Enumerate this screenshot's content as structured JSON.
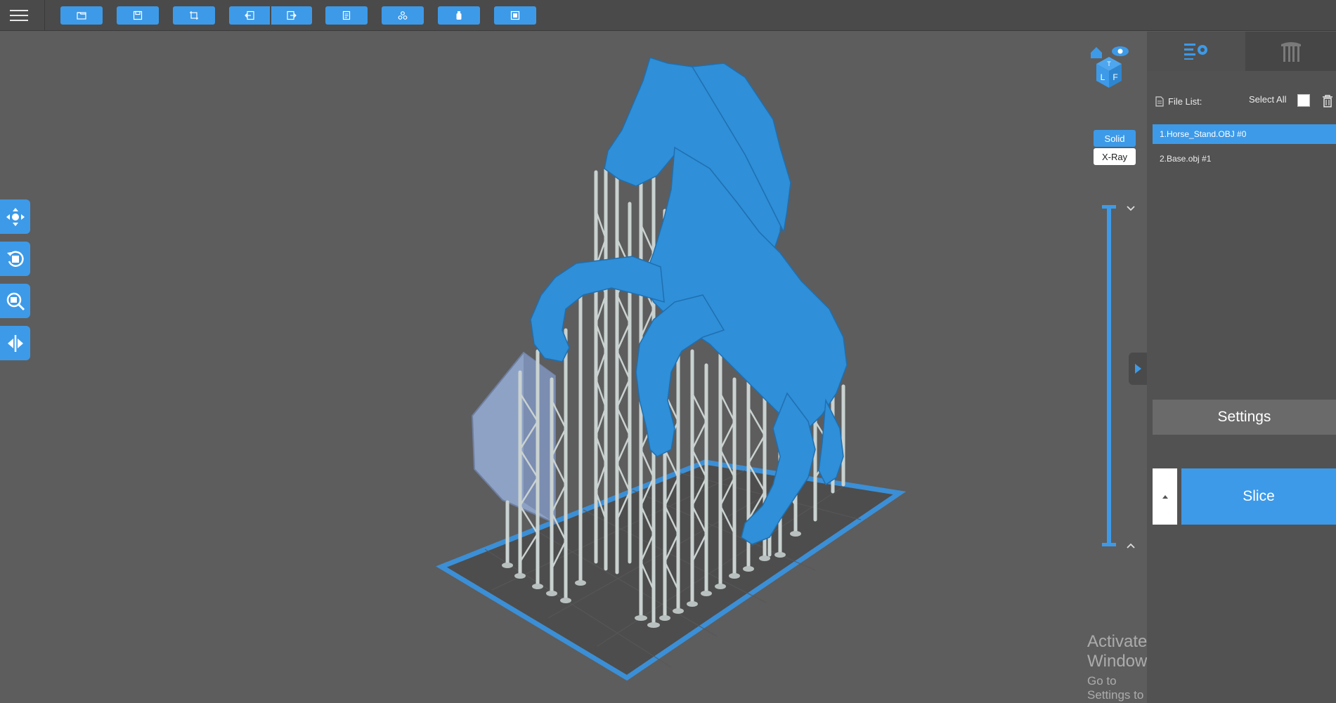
{
  "toolbar": {
    "buttons": [
      {
        "name": "open-file-button",
        "icon": "folder-icon"
      },
      {
        "name": "save-file-button",
        "icon": "save-icon"
      },
      {
        "name": "crop-tool-button",
        "icon": "crop-icon"
      },
      {
        "name": "import-button",
        "icon": "import-icon"
      },
      {
        "name": "export-button",
        "icon": "export-icon"
      },
      {
        "name": "document-button",
        "icon": "document-icon"
      },
      {
        "name": "arrange-button",
        "icon": "arrange-icon"
      },
      {
        "name": "resin-button",
        "icon": "bottle-icon"
      },
      {
        "name": "screen-button",
        "icon": "screen-icon"
      }
    ]
  },
  "viewport": {
    "left_tools": [
      "move-tool",
      "rotate-tool",
      "scale-tool",
      "mirror-tool"
    ],
    "view_cube": {
      "faces": [
        "L",
        "F",
        "T"
      ]
    },
    "render_modes": {
      "solid": "Solid",
      "xray": "X-Ray",
      "active": "Solid"
    }
  },
  "right_panel": {
    "tabs": [
      "settings-tab",
      "supports-tab"
    ],
    "file_list_label": "File List:",
    "select_all_label": "Select All",
    "files": [
      {
        "label": "1.Horse_Stand.OBJ #0",
        "selected": true
      },
      {
        "label": "2.Base.obj #1",
        "selected": false
      }
    ],
    "settings_label": "Settings",
    "slice_label": "Slice"
  },
  "watermark": {
    "title": "Activate Windows",
    "subtitle": "Go to Settings to activate Windows."
  },
  "colors": {
    "accent": "#3d9ae8",
    "model": "#2f8fd8",
    "supports": "#c9d2d0",
    "background": "#5d5d5d"
  }
}
